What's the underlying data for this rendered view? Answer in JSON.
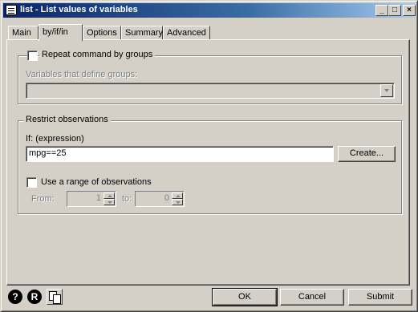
{
  "window": {
    "title": "list - List values of variables",
    "controls": {
      "minimize": "_",
      "maximize": "□",
      "close": "×"
    }
  },
  "tabs": [
    {
      "label": "Main",
      "active": false
    },
    {
      "label": "by/if/in",
      "active": true
    },
    {
      "label": "Options",
      "active": false
    },
    {
      "label": "Summary",
      "active": false
    },
    {
      "label": "Advanced",
      "active": false
    }
  ],
  "by_group": {
    "checkbox_label": "Repeat command by groups",
    "checked": false,
    "vars_label": "Variables that define groups:",
    "vars_value": ""
  },
  "restrict": {
    "title": "Restrict observations",
    "if_label": "If: (expression)",
    "if_value": "mpg==25",
    "create_button": "Create...",
    "range_checkbox_label": "Use a range of observations",
    "range_checked": false,
    "from_label": "From:",
    "from_value": "1",
    "to_label": "to:",
    "to_value": "0"
  },
  "footer": {
    "help_icon": "help-icon",
    "reset_icon": "reset-icon",
    "copy_icon": "copy-icon",
    "help_glyph": "?",
    "reset_glyph": "R",
    "ok": "OK",
    "cancel": "Cancel",
    "submit": "Submit"
  },
  "colors": {
    "face": "#d4d0c8",
    "title_start": "#0a246a",
    "title_end": "#a6caf0",
    "disabled_text": "#808080"
  }
}
